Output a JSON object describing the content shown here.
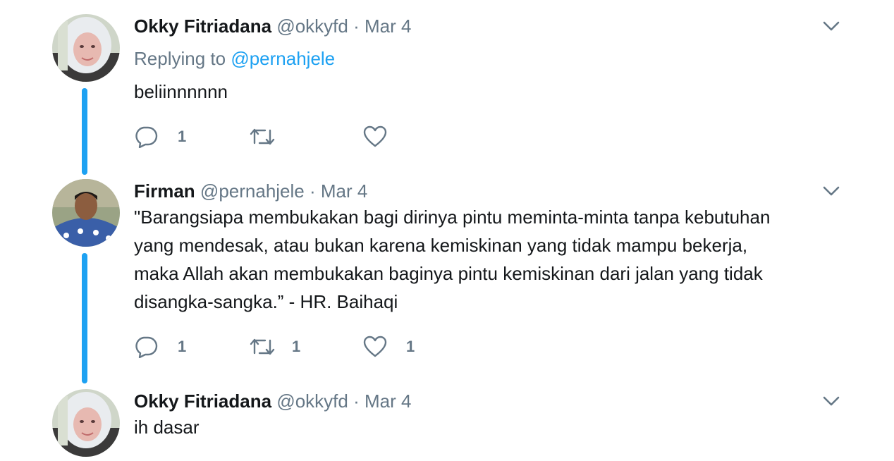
{
  "tweets": [
    {
      "name": "Okky Fitriadana",
      "handle": "@okkyfd",
      "separator": "·",
      "date": "Mar 4",
      "replying_label": "Replying to",
      "replying_to": "@pernahjele",
      "text": "beliinnnnnn",
      "replies": "1",
      "retweets": "",
      "likes": ""
    },
    {
      "name": "Firman",
      "handle": "@pernahjele",
      "separator": "·",
      "date": "Mar 4",
      "text_lines": [
        "\"Barangsiapa membukakan bagi dirinya pintu meminta-minta tanpa kebutuhan",
        "yang mendesak, atau bukan karena kemiskinan yang tidak mampu bekerja,",
        "maka Allah akan membukakan baginya pintu kemiskinan dari jalan yang tidak",
        "disangka-sangka.” - HR. Baihaqi"
      ],
      "replies": "1",
      "retweets": "1",
      "likes": "1"
    },
    {
      "name": "Okky Fitriadana",
      "handle": "@okkyfd",
      "separator": "·",
      "date": "Mar 4",
      "text": "ih dasar"
    }
  ],
  "colors": {
    "accent": "#1da1f2",
    "muted": "#657786",
    "text": "#14171a"
  },
  "icons": [
    "reply-icon",
    "retweet-icon",
    "like-icon",
    "chevron-down-icon"
  ]
}
